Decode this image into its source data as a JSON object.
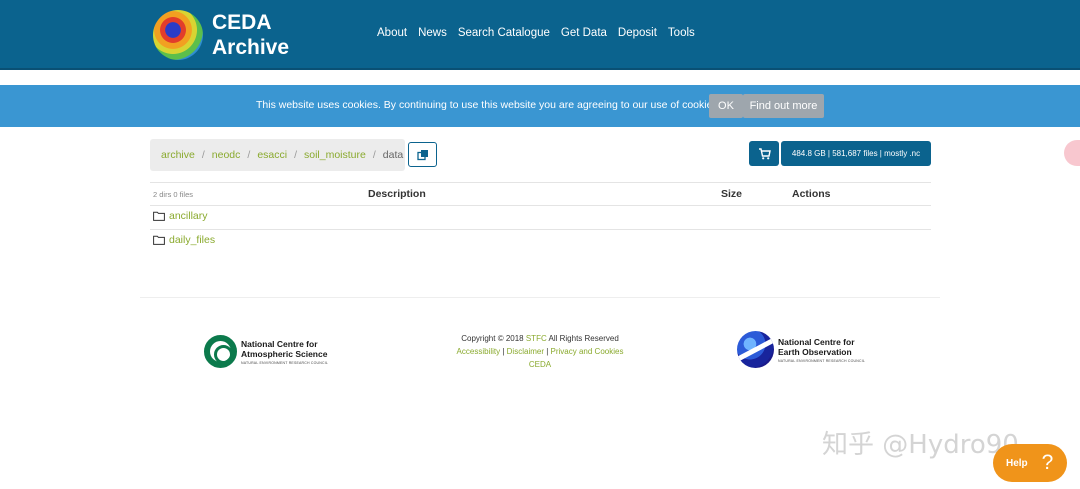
{
  "header": {
    "logo_line1": "CEDA",
    "logo_line2": "Archive",
    "nav": [
      "About",
      "News",
      "Search Catalogue",
      "Get Data",
      "Deposit",
      "Tools"
    ]
  },
  "cookie": {
    "message": "This website uses cookies. By continuing to use this website you are agreeing to our use of cookies.",
    "ok_label": "OK",
    "find_out_label": "Find out more"
  },
  "breadcrumb": [
    "archive",
    "neodc",
    "esacci",
    "soil_moisture",
    "data"
  ],
  "toolbar": {
    "size_label": "484.8 GB | 581,687 files | mostly .nc"
  },
  "table": {
    "count_label": "2 dirs 0 files",
    "headers": {
      "description": "Description",
      "size": "Size",
      "actions": "Actions"
    },
    "rows": [
      "ancillary",
      "daily_files"
    ]
  },
  "footer": {
    "left_logo_title_1": "National Centre for",
    "left_logo_title_2": "Atmospheric Science",
    "left_logo_sub": "NATURAL ENVIRONMENT RESEARCH COUNCIL",
    "copyright_prefix": "Copyright © 2018 ",
    "copyright_link": "STFC",
    "copyright_suffix": " All Rights Reserved",
    "links": [
      "Accessibility",
      "Disclaimer",
      "Privacy and Cookies"
    ],
    "ceda_link": "CEDA",
    "right_logo_title_1": "National Centre for",
    "right_logo_title_2": "Earth Observation",
    "right_logo_sub": "NATURAL ENVIRONMENT RESEARCH COUNCIL"
  },
  "watermark": "知乎 @Hydro90",
  "help": {
    "label": "Help",
    "icon": "?"
  },
  "colors": {
    "header": "#0b638e",
    "cookie_bar": "#3a96d2",
    "link": "#8aaa2e",
    "help": "#f0941a"
  }
}
